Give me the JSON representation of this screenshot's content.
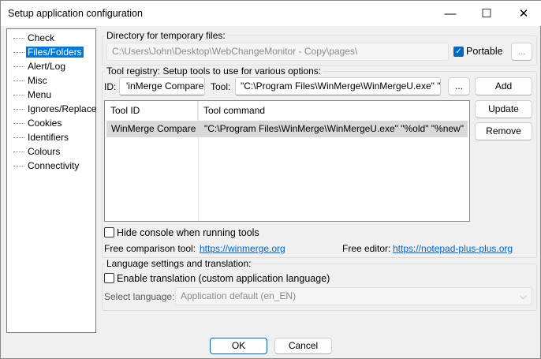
{
  "window": {
    "title": "Setup application configuration",
    "minimize": "—",
    "maximize": "☐",
    "close": "✕"
  },
  "tree": {
    "items": [
      "Check",
      "Files/Folders",
      "Alert/Log",
      "Misc",
      "Menu",
      "Ignores/Replace",
      "Cookies",
      "Identifiers",
      "Colours",
      "Connectivity"
    ],
    "selected": "Files/Folders"
  },
  "temp_dir": {
    "label": "Directory for temporary files:",
    "value": "C:\\Users\\John\\Desktop\\WebChangeMonitor - Copy\\pages\\",
    "portable_label": "Portable",
    "portable_checked": true,
    "browse": "..."
  },
  "tools": {
    "label": "Tool registry: Setup tools to use for various options:",
    "id_label": "ID:",
    "id_value": "'inMerge Compare",
    "tool_label": "Tool:",
    "tool_value": "\"C:\\Program Files\\WinMerge\\WinMergeU.exe\" \"",
    "browse": "...",
    "add": "Add",
    "update": "Update",
    "remove": "Remove",
    "columns": [
      "Tool ID",
      "Tool command"
    ],
    "rows": [
      {
        "id": "WinMerge Compare",
        "command": "\"C:\\Program Files\\WinMerge\\WinMergeU.exe\" \"%old\" \"%new\""
      }
    ],
    "hide_console": "Hide console when running tools",
    "free_compare_label": "Free comparison tool:",
    "free_compare_link": "https://winmerge.org",
    "free_editor_label": "Free editor:",
    "free_editor_link": "https://notepad-plus-plus.org"
  },
  "language": {
    "label": "Language settings and translation:",
    "enable": "Enable translation (custom application language)",
    "select_label": "Select language:",
    "selected": "Application default (en_EN)"
  },
  "buttons": {
    "ok": "OK",
    "cancel": "Cancel"
  },
  "colors": {
    "accent": "#0078d7",
    "checkbox": "#0067c0",
    "link": "#0066cc"
  }
}
